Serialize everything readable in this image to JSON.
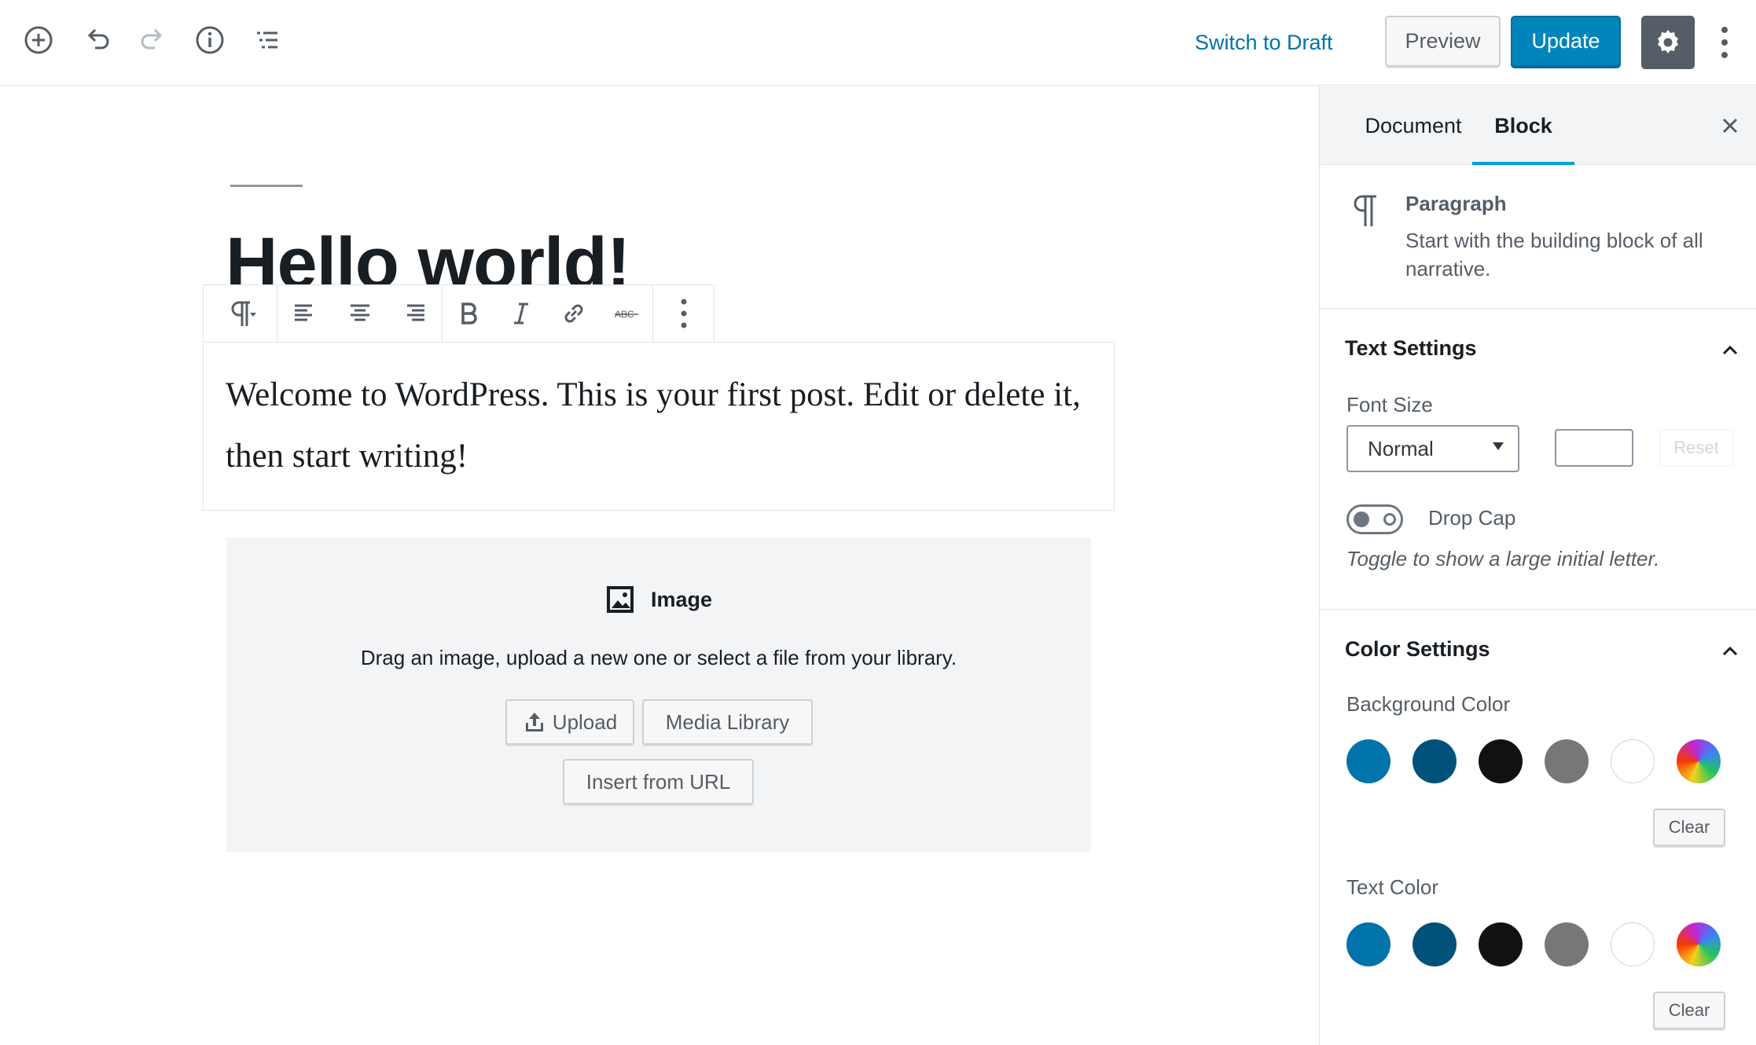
{
  "header": {
    "switch_to_draft": "Switch to Draft",
    "preview": "Preview",
    "update": "Update",
    "icons": [
      "add-block-icon",
      "undo-icon",
      "redo-icon",
      "info-icon",
      "outline-icon",
      "gear-icon",
      "more-vertical-icon"
    ]
  },
  "editor": {
    "title": "Hello world!",
    "paragraph": "Welcome to WordPress. This is your first post. Edit or delete it, then start writing!",
    "toolbar_icons": [
      "paragraph-icon",
      "align-left-icon",
      "align-center-icon",
      "align-right-icon",
      "bold-icon",
      "italic-icon",
      "link-icon",
      "strikethrough-icon",
      "more-options-icon"
    ],
    "image_block": {
      "label": "Image",
      "instructions": "Drag an image, upload a new one or select a file from your library.",
      "upload": "Upload",
      "media_library": "Media Library",
      "insert_url": "Insert from URL"
    }
  },
  "sidebar": {
    "tabs": {
      "document": "Document",
      "block": "Block"
    },
    "active_tab": "Block",
    "block_card": {
      "title": "Paragraph",
      "description": "Start with the building block of all narrative."
    },
    "text_settings": {
      "title": "Text Settings",
      "font_size_label": "Font Size",
      "font_size_value": "Normal",
      "reset": "Reset",
      "drop_cap_label": "Drop Cap",
      "drop_cap_help": "Toggle to show a large initial letter.",
      "drop_cap_enabled": false
    },
    "color_settings": {
      "title": "Color Settings",
      "background_label": "Background Color",
      "text_label": "Text Color",
      "clear": "Clear",
      "palette": [
        "#0073aa",
        "#00527a",
        "#111111",
        "#777777",
        "#ffffff",
        "gradient"
      ]
    }
  },
  "colors": {
    "accent": "#0085ba",
    "link": "#0073aa",
    "tab_indicator": "#00a0d2"
  }
}
